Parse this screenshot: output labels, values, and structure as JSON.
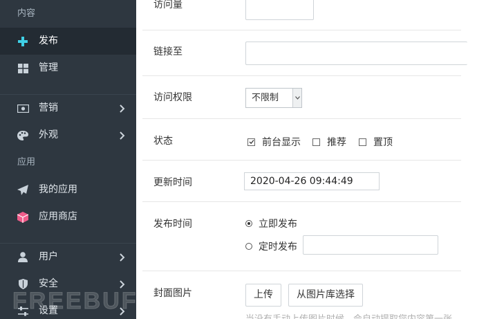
{
  "sidebar": {
    "section_content": "内容",
    "section_apps": "应用",
    "items": [
      {
        "label": "发布",
        "icon": "plus-icon"
      },
      {
        "label": "管理",
        "icon": "grid-icon"
      },
      {
        "label": "营销",
        "icon": "money-icon"
      },
      {
        "label": "外观",
        "icon": "palette-icon"
      },
      {
        "label": "我的应用",
        "icon": "paper-plane-icon"
      },
      {
        "label": "应用商店",
        "icon": "cube-icon"
      },
      {
        "label": "用户",
        "icon": "user-icon"
      },
      {
        "label": "安全",
        "icon": "shield-icon"
      },
      {
        "label": "设置",
        "icon": "sliders-icon"
      }
    ],
    "active_index": 0,
    "accent_plus": "#3fd0e6",
    "accent_cube": "#ef5c8a"
  },
  "watermark": "FREEBUF",
  "form": {
    "visits_label": "访问量",
    "link_label": "链接至",
    "access_label": "访问权限",
    "access_value": "不限制",
    "status_label": "状态",
    "status_options": [
      {
        "label": "前台显示",
        "checked": true
      },
      {
        "label": "推荐",
        "checked": false
      },
      {
        "label": "置顶",
        "checked": false
      }
    ],
    "update_time_label": "更新时间",
    "update_time_value": "2020-04-26 09:44:49",
    "publish_time_label": "发布时间",
    "publish_now_label": "立即发布",
    "publish_scheduled_label": "定时发布",
    "publish_mode": "now",
    "cover_label": "封面图片",
    "upload_button": "上传",
    "library_button": "从图片库选择",
    "cover_hint": "当没有手动上传图片时候，会自动提取您内容第一张"
  }
}
